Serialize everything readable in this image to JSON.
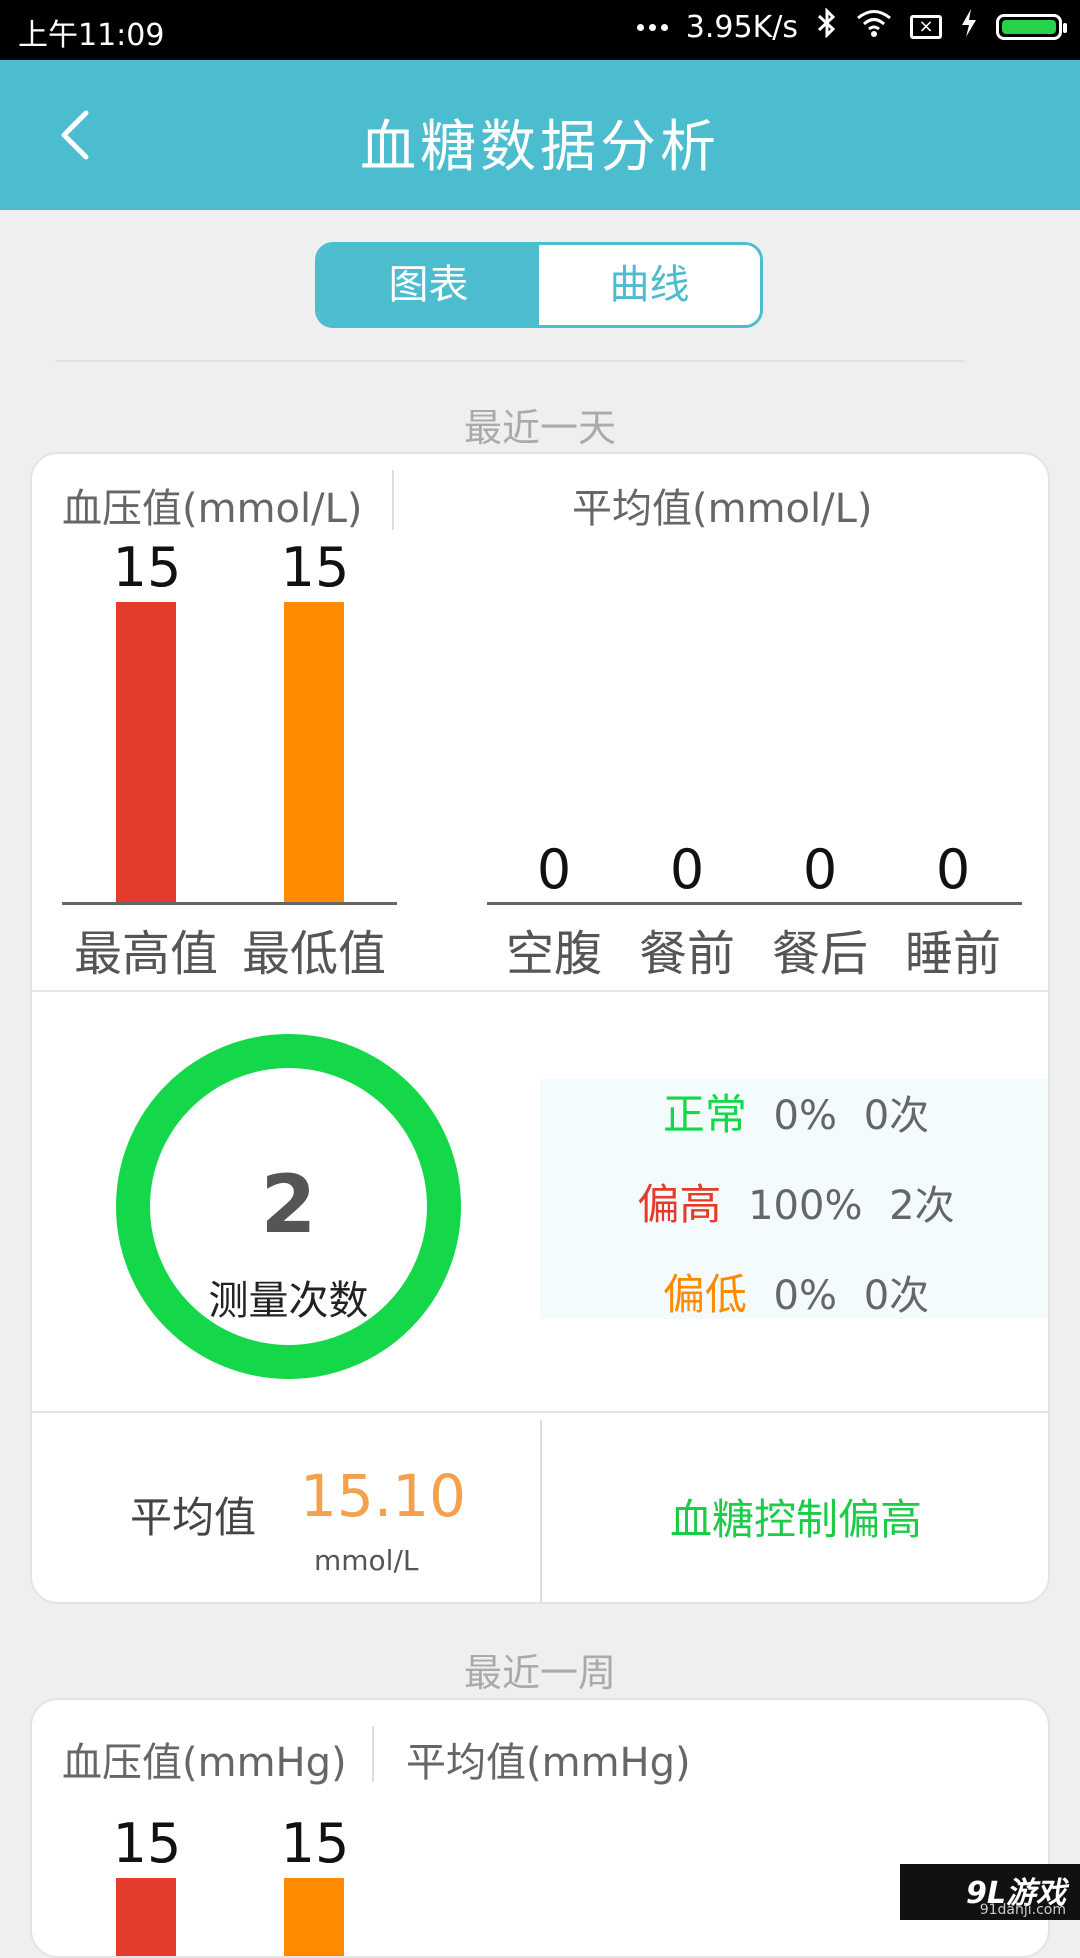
{
  "status_bar": {
    "time": "上午11:09",
    "speed": "3.95K/s"
  },
  "app_bar": {
    "title": "血糖数据分析"
  },
  "tabs": [
    {
      "label": "图表",
      "active": true
    },
    {
      "label": "曲线",
      "active": false
    }
  ],
  "colors": {
    "accent": "#4cbccf",
    "high": "#e53b2c",
    "low": "#ff8a00",
    "normal": "#14d84a"
  },
  "sections": {
    "day": {
      "label": "最近一天",
      "left_title": "血压值(mmol/L)",
      "right_title": "平均值(mmol/L)",
      "chart_data": [
        {
          "type": "bar",
          "categories": [
            "最高值",
            "最低值"
          ],
          "values": [
            15,
            15
          ],
          "ylim": [
            0,
            15
          ]
        },
        {
          "type": "bar",
          "categories": [
            "空腹",
            "餐前",
            "餐后",
            "睡前"
          ],
          "values": [
            0,
            0,
            0,
            0
          ]
        }
      ],
      "measure_count": "2",
      "measure_label": "测量次数",
      "stats": [
        {
          "label": "正常",
          "percent": "0%",
          "times": "0次",
          "color": "#14d84a"
        },
        {
          "label": "偏高",
          "percent": "100%",
          "times": "2次",
          "color": "#e53b2c"
        },
        {
          "label": "偏低",
          "percent": "0%",
          "times": "0次",
          "color": "#ff8a00"
        }
      ],
      "average_label": "平均值",
      "average_value": "15.10",
      "average_unit": "mmol/L",
      "verdict": "血糖控制偏高"
    },
    "week": {
      "label": "最近一周",
      "left_title": "血压值(mmHg)",
      "right_title": "平均值(mmHg)",
      "chart_data": {
        "type": "bar",
        "values": [
          15,
          15
        ]
      }
    }
  },
  "watermark": {
    "brand": "9L游戏",
    "site": "91danji.com"
  }
}
